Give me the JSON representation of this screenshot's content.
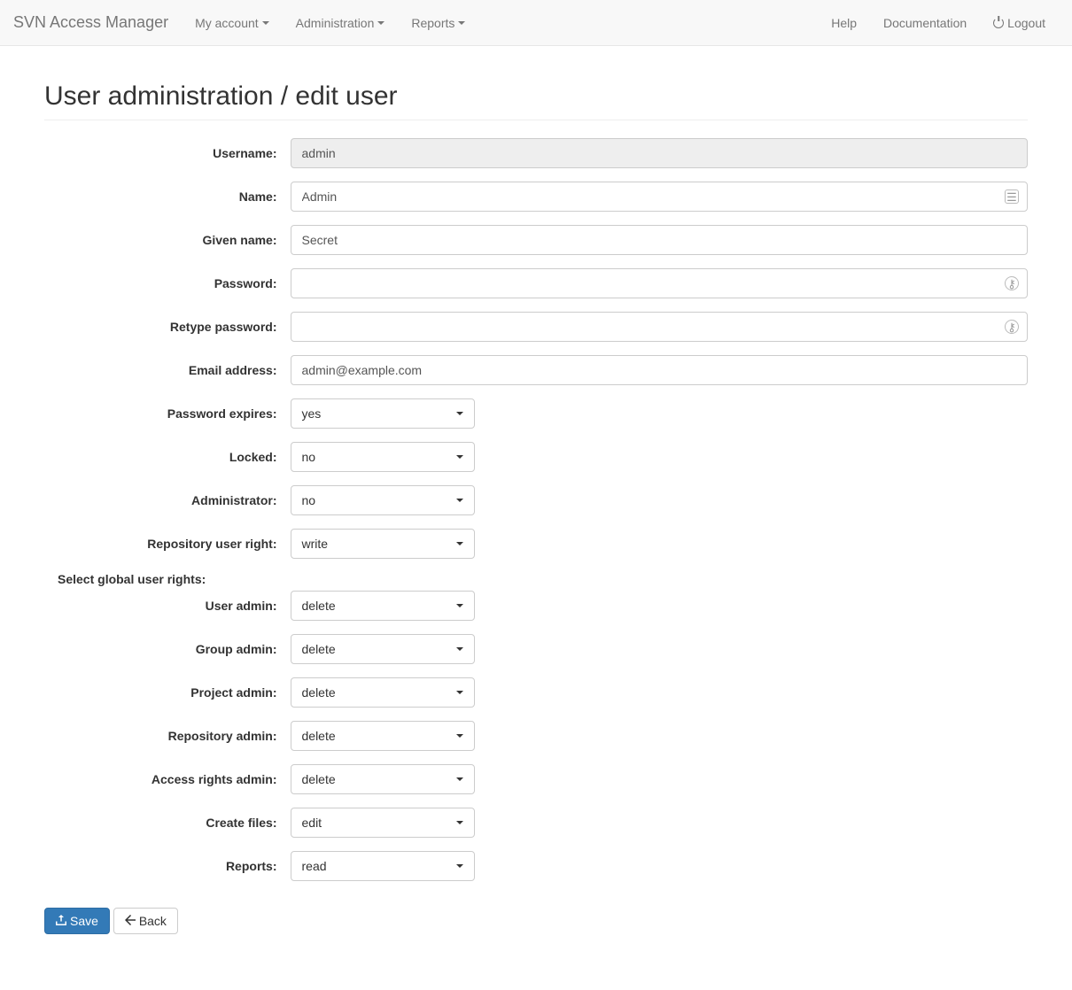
{
  "navbar": {
    "brand": "SVN Access Manager",
    "left": [
      {
        "label": "My account",
        "caret": true
      },
      {
        "label": "Administration",
        "caret": true
      },
      {
        "label": "Reports",
        "caret": true
      }
    ],
    "right": [
      {
        "label": "Help"
      },
      {
        "label": "Documentation"
      },
      {
        "label": "Logout",
        "power": true
      }
    ]
  },
  "page": {
    "title": "User administration / edit user"
  },
  "form": {
    "username": {
      "label": "Username:",
      "value": "admin"
    },
    "name": {
      "label": "Name:",
      "value": "Admin"
    },
    "givenname": {
      "label": "Given name:",
      "value": "Secret"
    },
    "password": {
      "label": "Password:",
      "value": ""
    },
    "retype_password": {
      "label": "Retype password:",
      "value": ""
    },
    "email": {
      "label": "Email address:",
      "value": "admin@example.com"
    },
    "password_expires": {
      "label": "Password expires:",
      "value": "yes"
    },
    "locked": {
      "label": "Locked:",
      "value": "no"
    },
    "administrator": {
      "label": "Administrator:",
      "value": "no"
    },
    "repo_user_right": {
      "label": "Repository user right:",
      "value": "write"
    },
    "section_label": "Select global user rights:",
    "user_admin": {
      "label": "User admin:",
      "value": "delete"
    },
    "group_admin": {
      "label": "Group admin:",
      "value": "delete"
    },
    "project_admin": {
      "label": "Project admin:",
      "value": "delete"
    },
    "repository_admin": {
      "label": "Repository admin:",
      "value": "delete"
    },
    "access_rights_admin": {
      "label": "Access rights admin:",
      "value": "delete"
    },
    "create_files": {
      "label": "Create files:",
      "value": "edit"
    },
    "reports": {
      "label": "Reports:",
      "value": "read"
    }
  },
  "buttons": {
    "save": "Save",
    "back": "Back"
  }
}
